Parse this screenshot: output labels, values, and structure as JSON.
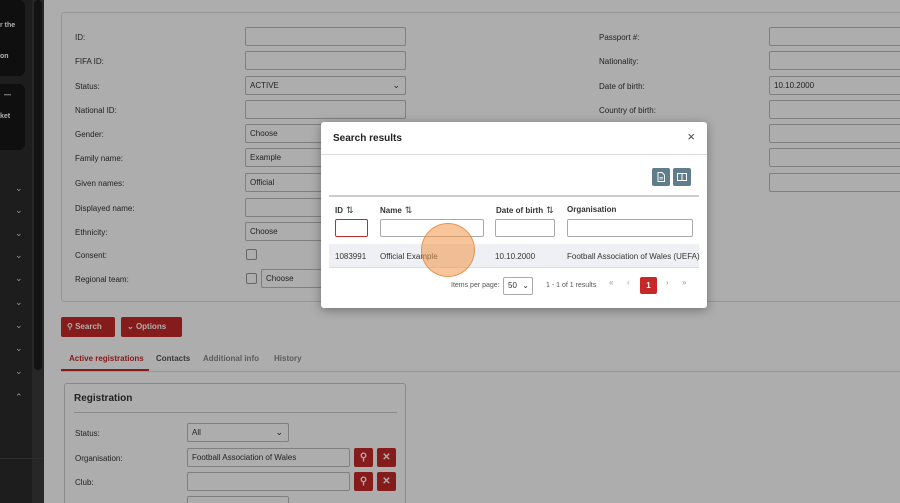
{
  "sidebar": {
    "cards": [
      {
        "lines": [
          "r the",
          "on"
        ]
      },
      {
        "lines": [
          "—",
          "ket"
        ]
      }
    ]
  },
  "form": {
    "left_labels": [
      "ID:",
      "FIFA ID:",
      "Status:",
      "National ID:",
      "Gender:",
      "Family name:",
      "Given names:",
      "Displayed name:",
      "Ethnicity:",
      "Consent:",
      "Regional team:"
    ],
    "status_value": "ACTIVE",
    "gender_value": "Choose",
    "family_name_value": "Example",
    "given_names_value": "Official",
    "ethnicity_value": "Choose",
    "regional_team_value": "Choose",
    "right_labels": [
      "Passport #:",
      "Nationality:",
      "Date of birth:",
      "Country of birth:"
    ],
    "dob_value": "10.10.2000"
  },
  "actions": {
    "search_label": "Search",
    "options_label": "Options"
  },
  "tabs": [
    "Active registrations",
    "Contacts",
    "Additional info",
    "History"
  ],
  "registration": {
    "title": "Registration",
    "status_label": "Status:",
    "status_value": "All",
    "organisation_label": "Organisation:",
    "organisation_value": "Football Association of Wales",
    "club_label": "Club:"
  },
  "modal": {
    "title": "Search results",
    "close": "×",
    "columns": [
      {
        "label": "ID",
        "sort": "⇅"
      },
      {
        "label": "Name",
        "sort": "⇅"
      },
      {
        "label": "Date of birth",
        "sort": "⇅"
      },
      {
        "label": "Organisation",
        "sort": ""
      }
    ],
    "rows": [
      {
        "id": "1083991",
        "name": "Official Example",
        "dob": "10.10.2000",
        "organisation": "Football Association of Wales (UEFA)"
      }
    ],
    "pager": {
      "items_per_page_label": "Items per page:",
      "items_per_page": "50",
      "range": "1 - 1 of 1 results",
      "current_page": "1",
      "first": "«",
      "prev": "‹",
      "next": "›",
      "last": "»"
    }
  },
  "colors": {
    "accent": "#c62828",
    "tool_button": "#607d8b"
  }
}
